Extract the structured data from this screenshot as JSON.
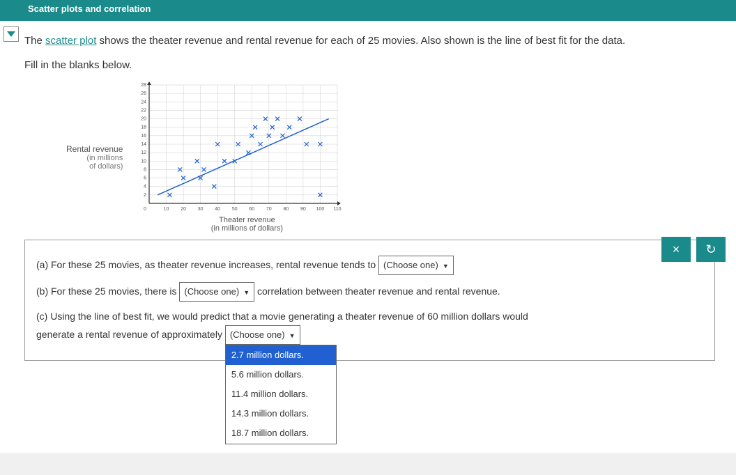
{
  "topbar": {
    "title": "Scatter plots and correlation"
  },
  "problem": {
    "intro_prefix": "The ",
    "link_text": "scatter plot",
    "intro_suffix": " shows the theater revenue and rental revenue for each of 25 movies. Also shown is the line of best fit for the data.",
    "instruction": "Fill in the blanks below."
  },
  "chart_data": {
    "type": "scatter",
    "title": "",
    "xlabel": "Theater revenue",
    "xlabel_sub": "(in millions of dollars)",
    "ylabel": "Rental revenue",
    "ylabel_sub_top": "(in millions",
    "ylabel_sub_bot": "of dollars)",
    "xlim": [
      0,
      110
    ],
    "ylim": [
      0,
      28
    ],
    "xticks": [
      0,
      10,
      20,
      30,
      40,
      50,
      60,
      70,
      80,
      90,
      100,
      110
    ],
    "yticks": [
      0,
      2,
      4,
      6,
      8,
      10,
      12,
      14,
      16,
      18,
      20,
      22,
      24,
      26,
      28
    ],
    "points": [
      [
        12,
        2
      ],
      [
        18,
        8
      ],
      [
        20,
        6
      ],
      [
        28,
        10
      ],
      [
        30,
        6
      ],
      [
        32,
        8
      ],
      [
        38,
        4
      ],
      [
        40,
        14
      ],
      [
        44,
        10
      ],
      [
        50,
        10
      ],
      [
        52,
        14
      ],
      [
        58,
        12
      ],
      [
        60,
        16
      ],
      [
        62,
        18
      ],
      [
        65,
        14
      ],
      [
        68,
        20
      ],
      [
        70,
        16
      ],
      [
        72,
        18
      ],
      [
        75,
        20
      ],
      [
        78,
        16
      ],
      [
        82,
        18
      ],
      [
        88,
        20
      ],
      [
        92,
        14
      ],
      [
        100,
        2
      ],
      [
        100,
        14
      ]
    ],
    "best_fit_line": {
      "x1": 5,
      "y1": 2,
      "x2": 105,
      "y2": 20
    }
  },
  "questions": {
    "a_prefix": "(a) For these 25 movies, as theater revenue increases, rental revenue tends to ",
    "a_dropdown": "(Choose one)",
    "b_prefix": "(b) For these 25 movies, there is ",
    "b_dropdown": "(Choose one)",
    "b_suffix": " correlation between theater revenue and rental revenue.",
    "c_line1": "(c) Using the line of best fit, we would predict that a movie generating a theater revenue of 60 million dollars would",
    "c_line2_prefix": "generate a rental revenue of approximately ",
    "c_dropdown": "(Choose one)",
    "c_options": [
      "2.7 million dollars.",
      "5.6 million dollars.",
      "11.4 million dollars.",
      "14.3 million dollars.",
      "18.7 million dollars."
    ]
  },
  "buttons": {
    "close": "×",
    "reset": "↻"
  }
}
